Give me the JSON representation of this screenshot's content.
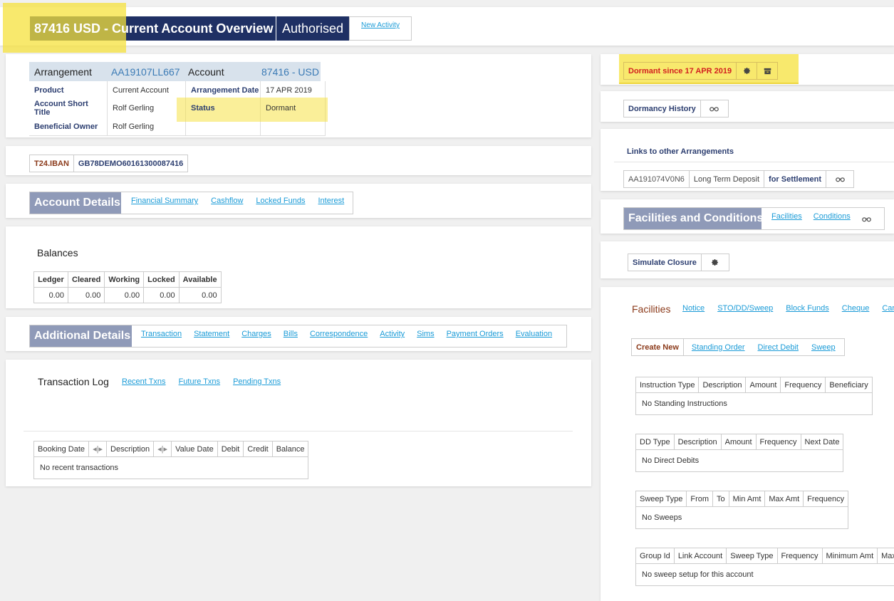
{
  "header": {
    "title": "87416 USD - Current Account Overview",
    "status": "Authorised",
    "new_activity": "New Activity"
  },
  "arrangement": {
    "arrangement_label": "Arrangement",
    "arrangement_id": "AA19107LL667",
    "account_label": "Account",
    "account_value": "87416 - USD",
    "rows": [
      {
        "k1": "Product",
        "v1": "Current Account",
        "k2": "Arrangement Date",
        "v2": "17 APR 2019"
      },
      {
        "k1": "Account Short Title",
        "v1": "Rolf Gerling",
        "k2": "Status",
        "v2": "Dormant"
      },
      {
        "k1": "Beneficial Owner",
        "v1": "Rolf Gerling",
        "k2": "",
        "v2": ""
      }
    ]
  },
  "iban": {
    "label": "T24.IBAN",
    "value": "GB78DEMO60161300087416"
  },
  "account_details": {
    "title": "Account Details",
    "links": [
      "Financial Summary",
      "Cashflow",
      "Locked Funds",
      "Interest"
    ]
  },
  "balances": {
    "title": "Balances",
    "headers": [
      "Ledger",
      "Cleared",
      "Working",
      "Locked",
      "Available"
    ],
    "values": [
      "0.00",
      "0.00",
      "0.00",
      "0.00",
      "0.00"
    ]
  },
  "additional_details": {
    "title": "Additional Details",
    "links": [
      "Transaction",
      "Statement",
      "Charges",
      "Bills",
      "Correspondence",
      "Activity",
      "Sims",
      "Payment Orders",
      "Evaluation"
    ]
  },
  "transaction_log": {
    "title": "Transaction Log",
    "links": [
      "Recent Txns",
      "Future Txns",
      "Pending Txns"
    ],
    "headers": [
      "Booking Date",
      "Description",
      "Value Date",
      "Debit",
      "Credit",
      "Balance"
    ],
    "empty": "No recent transactions"
  },
  "dormant": {
    "label": "Dormant since 17 APR 2019"
  },
  "dormancy_history": {
    "label": "Dormancy History"
  },
  "links_other": {
    "title": "Links to other Arrangements",
    "arrangement": "AA191074V0N6",
    "product": "Long Term Deposit",
    "purpose": "for Settlement"
  },
  "facilities_conditions": {
    "title": "Facilities and Conditions",
    "links": [
      "Facilities",
      "Conditions"
    ]
  },
  "simulate_closure": {
    "label": "Simulate Closure"
  },
  "facilities": {
    "title": "Facilities",
    "links": [
      "Notice",
      "STO/DD/Sweep",
      "Block Funds",
      "Cheque",
      "Card"
    ],
    "create_new": "Create New",
    "create_links": [
      "Standing Order",
      "Direct Debit",
      "Sweep"
    ],
    "standing": {
      "headers": [
        "Instruction Type",
        "Description",
        "Amount",
        "Frequency",
        "Beneficiary"
      ],
      "empty": "No Standing Instructions"
    },
    "direct_debits": {
      "headers": [
        "DD Type",
        "Description",
        "Amount",
        "Frequency",
        "Next Date"
      ],
      "empty": "No Direct Debits"
    },
    "sweeps": {
      "headers": [
        "Sweep Type",
        "From",
        "To",
        "Min Amt",
        "Max Amt",
        "Frequency"
      ],
      "empty": "No Sweeps"
    },
    "sweep_setup": {
      "headers": [
        "Group Id",
        "Link Account",
        "Sweep Type",
        "Frequency",
        "Minimum Amt",
        "Maximum Amt"
      ],
      "empty": "No sweep setup for this account"
    }
  },
  "colors": {
    "navy": "#1f3064",
    "section": "#8f9ab8",
    "link": "#1a9bd7",
    "highlight": "#f5e13c",
    "dormant_red": "#d32020"
  }
}
